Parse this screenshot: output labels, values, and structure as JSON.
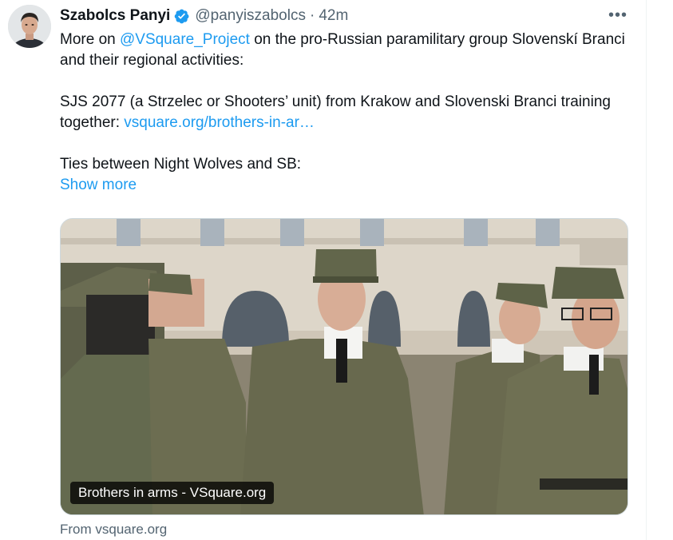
{
  "tweet": {
    "author_name": "Szabolcs Panyi",
    "handle": "@panyiszabolcs",
    "separator": "·",
    "time": "42m",
    "more_icon": "ellipsis-icon",
    "verified_color": "#1d9bf0",
    "paragraph1": {
      "prefix": "More on ",
      "mention": "@VSquare_Project",
      "suffix": " on the pro-Russian paramilitary group Slovenskí Branci and their regional activities:"
    },
    "paragraph2": {
      "text": "SJS 2077 (a Strzelec or Shooters’ unit) from Krakow and Slovenski Branci training together: ",
      "link": "vsquare.org/brothers-in-ar…"
    },
    "paragraph3": {
      "text": "Ties between Night Wolves and SB:"
    },
    "show_more": "Show more",
    "card": {
      "caption": "Brothers in arms  - VSquare.org",
      "source": "From vsquare.org"
    }
  },
  "colors": {
    "link": "#1d9bf0",
    "secondary_text": "#536471",
    "primary_text": "#0f1419"
  }
}
